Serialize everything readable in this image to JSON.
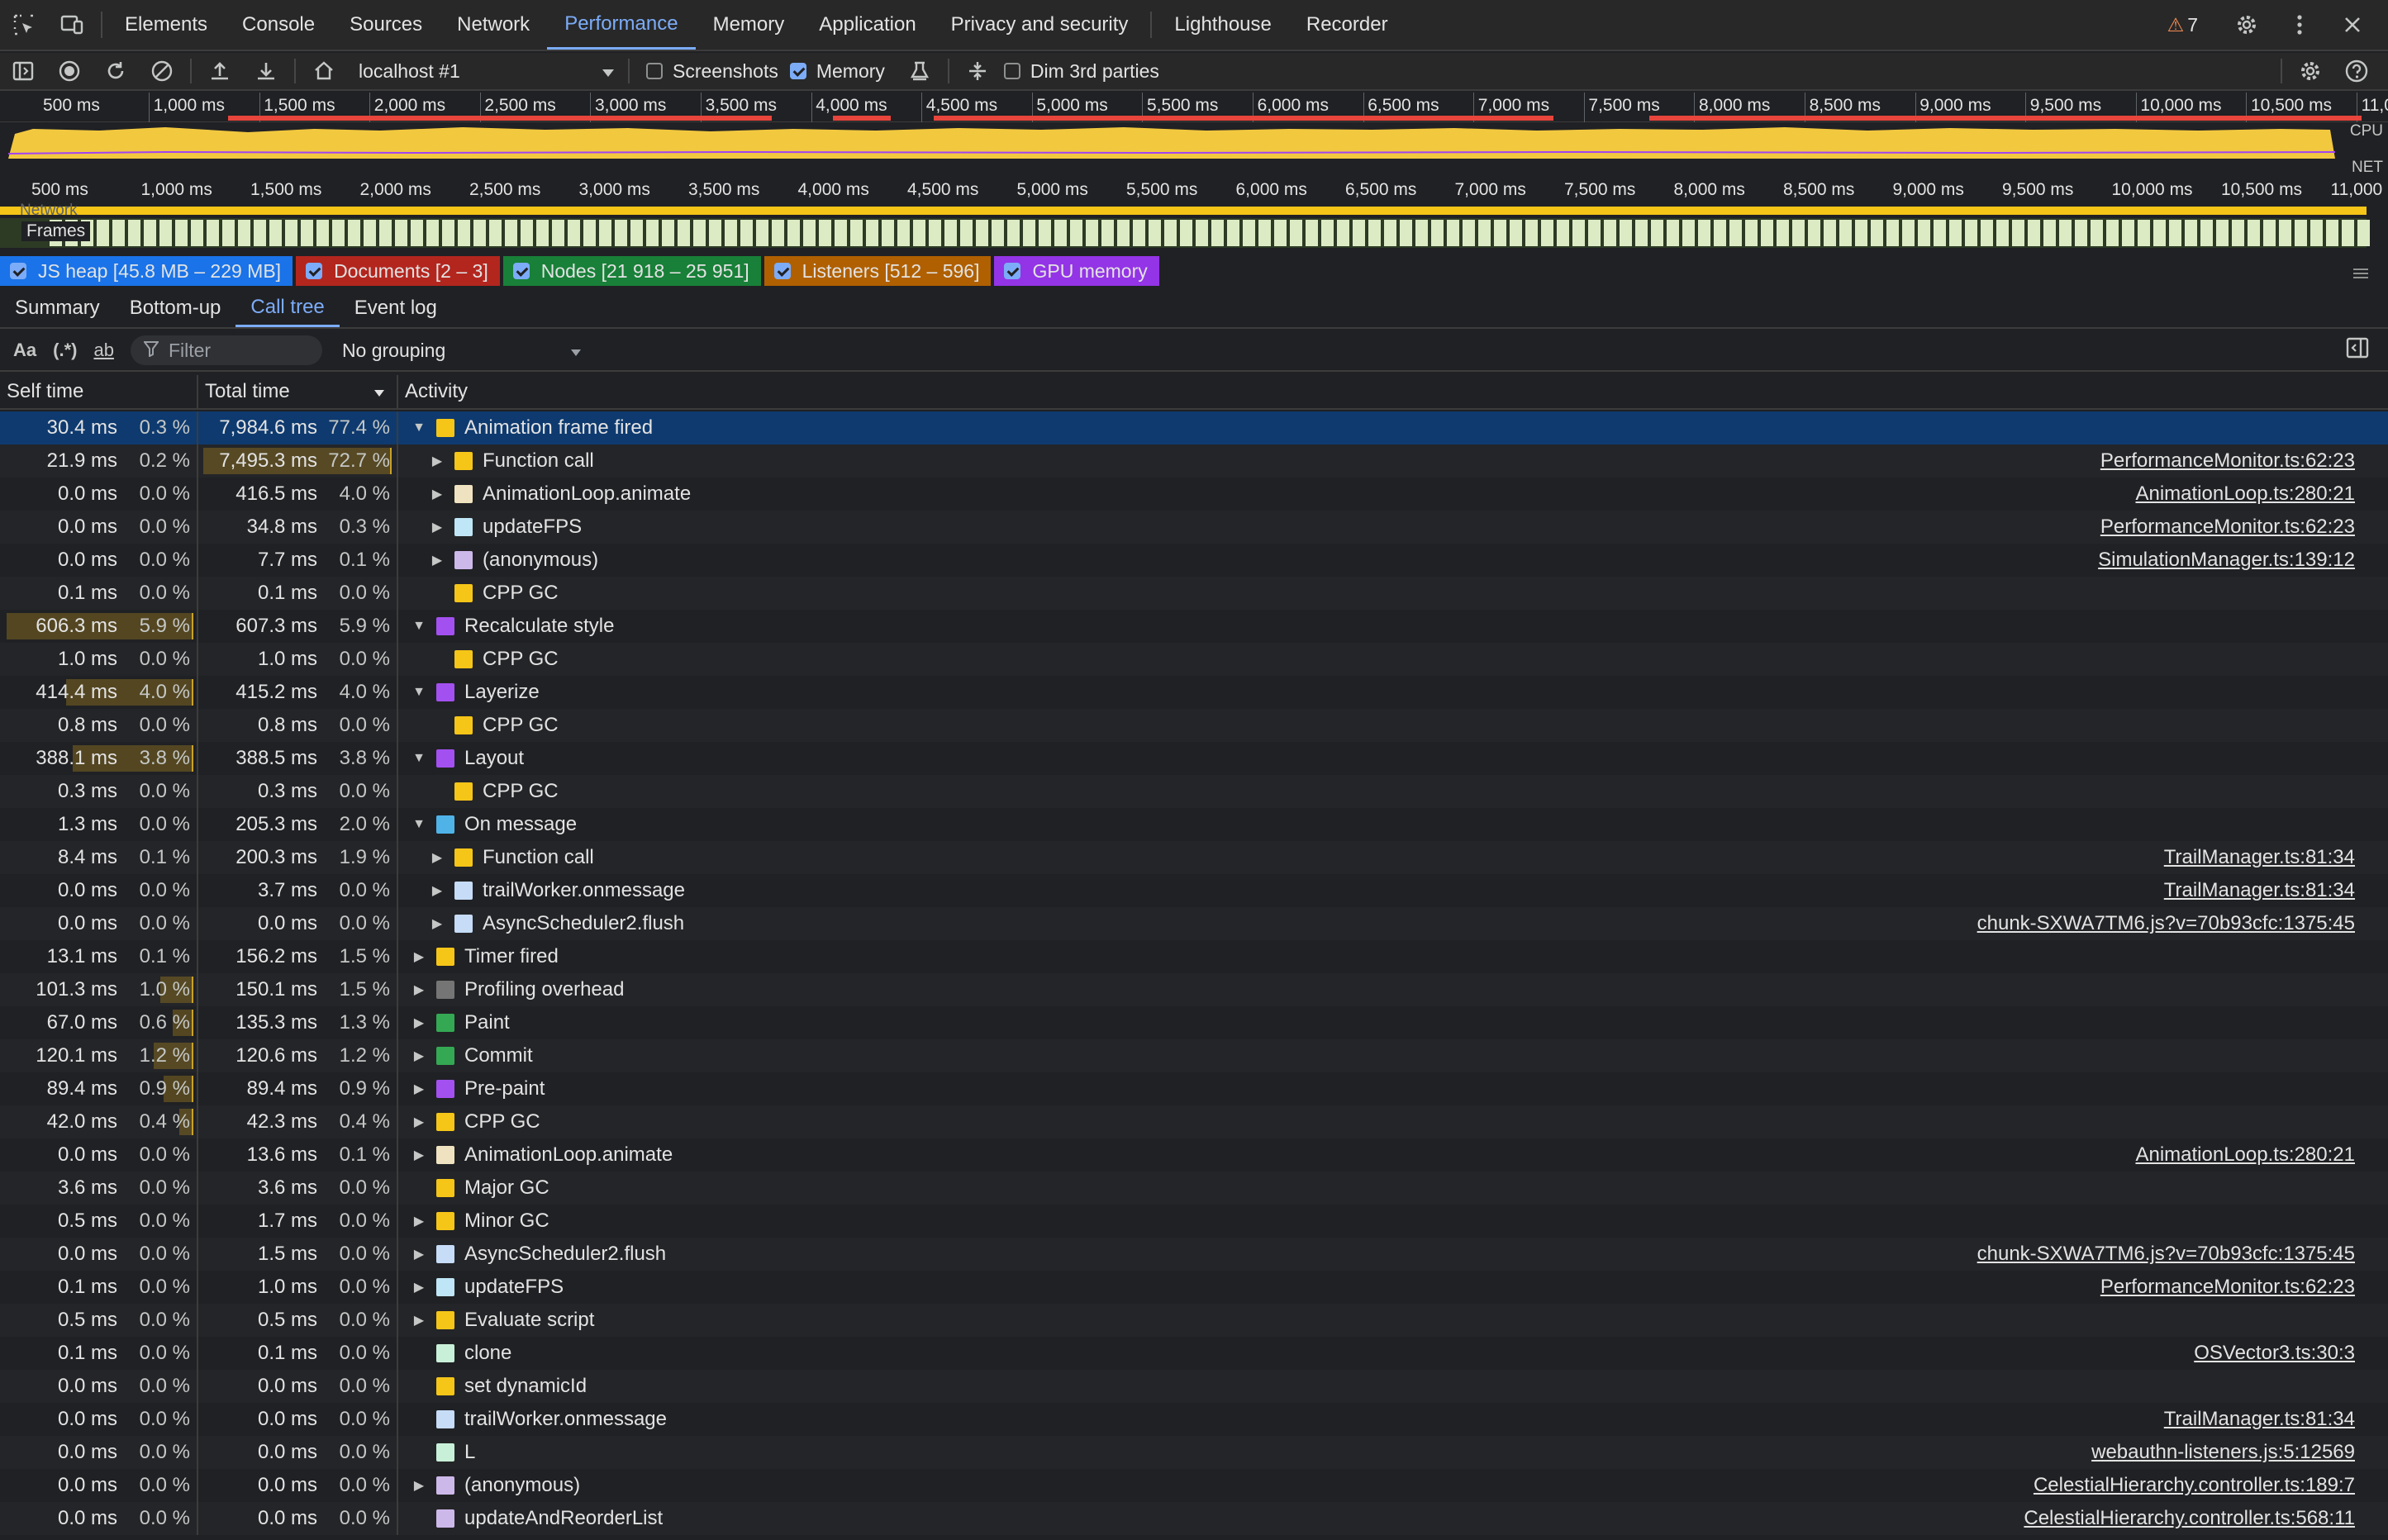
{
  "tabs": [
    "Elements",
    "Console",
    "Sources",
    "Network",
    "Performance",
    "Memory",
    "Application",
    "Privacy and security",
    "Lighthouse",
    "Recorder"
  ],
  "active_tab": "Performance",
  "issues_count": "7",
  "toolbar": {
    "target": "localhost #1",
    "screenshots_label": "Screenshots",
    "memory_label": "Memory",
    "dim_label": "Dim 3rd parties"
  },
  "ruler_top": [
    "500 ms",
    "1,000 ms",
    "1,500 ms",
    "2,000 ms",
    "2,500 ms",
    "3,000 ms",
    "3,500 ms",
    "4,000 ms",
    "4,500 ms",
    "5,000 ms",
    "5,500 ms",
    "6,000 ms",
    "6,500 ms",
    "7,000 ms",
    "7,500 ms",
    "8,000 ms",
    "8,500 ms",
    "9,000 ms",
    "9,500 ms",
    "10,000 ms",
    "10,500 ms",
    "11,0"
  ],
  "ruler_bottom": [
    "500 ms",
    "1,000 ms",
    "1,500 ms",
    "2,000 ms",
    "2,500 ms",
    "3,000 ms",
    "3,500 ms",
    "4,000 ms",
    "4,500 ms",
    "5,000 ms",
    "5,500 ms",
    "6,000 ms",
    "6,500 ms",
    "7,000 ms",
    "7,500 ms",
    "8,000 ms",
    "8,500 ms",
    "9,000 ms",
    "9,500 ms",
    "10,000 ms",
    "10,500 ms",
    "11,000"
  ],
  "cpu_label": "CPU",
  "net_label": "NET",
  "network_label": "Network",
  "frames_label": "Frames",
  "counters": [
    {
      "label": "JS heap [45.8 MB – 229 MB]",
      "color": "#1a73e8"
    },
    {
      "label": "Documents [2 – 3]",
      "color": "#b3261e"
    },
    {
      "label": "Nodes [21 918 – 25 951]",
      "color": "#188038"
    },
    {
      "label": "Listeners [512 – 596]",
      "color": "#b06000"
    },
    {
      "label": "GPU memory",
      "color": "#9334e6"
    }
  ],
  "detail_tabs": [
    "Summary",
    "Bottom-up",
    "Call tree",
    "Event log"
  ],
  "active_detail_tab": "Call tree",
  "filter_placeholder": "Filter",
  "grouping": "No grouping",
  "columns": {
    "self": "Self time",
    "total": "Total time",
    "activity": "Activity"
  },
  "rows": [
    {
      "self": "30.4 ms",
      "selfp": "0.3 %",
      "total": "7,984.6 ms",
      "totalp": "77.4 %",
      "name": "Animation frame fired",
      "indent": 0,
      "arrow": "down",
      "color": "#f5c518",
      "link": ""
    },
    {
      "self": "21.9 ms",
      "selfp": "0.2 %",
      "total": "7,495.3 ms",
      "totalp": "72.7 %",
      "name": "Function call",
      "indent": 1,
      "arrow": "right",
      "color": "#f5c518",
      "link": "PerformanceMonitor.ts:62:23"
    },
    {
      "self": "0.0 ms",
      "selfp": "0.0 %",
      "total": "416.5 ms",
      "totalp": "4.0 %",
      "name": "AnimationLoop.animate",
      "indent": 1,
      "arrow": "right",
      "color": "#efe2c0",
      "link": "AnimationLoop.ts:280:21"
    },
    {
      "self": "0.0 ms",
      "selfp": "0.0 %",
      "total": "34.8 ms",
      "totalp": "0.3 %",
      "name": "updateFPS",
      "indent": 1,
      "arrow": "right",
      "color": "#bfe6f7",
      "link": "PerformanceMonitor.ts:62:23"
    },
    {
      "self": "0.0 ms",
      "selfp": "0.0 %",
      "total": "7.7 ms",
      "totalp": "0.1 %",
      "name": "(anonymous)",
      "indent": 1,
      "arrow": "right",
      "color": "#cdb8ea",
      "link": "SimulationManager.ts:139:12"
    },
    {
      "self": "0.1 ms",
      "selfp": "0.0 %",
      "total": "0.1 ms",
      "totalp": "0.0 %",
      "name": "CPP GC",
      "indent": 1,
      "arrow": "",
      "color": "#f5c518",
      "link": ""
    },
    {
      "self": "606.3 ms",
      "selfp": "5.9 %",
      "total": "607.3 ms",
      "totalp": "5.9 %",
      "name": "Recalculate style",
      "indent": 0,
      "arrow": "down",
      "color": "#a350f0",
      "link": ""
    },
    {
      "self": "1.0 ms",
      "selfp": "0.0 %",
      "total": "1.0 ms",
      "totalp": "0.0 %",
      "name": "CPP GC",
      "indent": 1,
      "arrow": "",
      "color": "#f5c518",
      "link": ""
    },
    {
      "self": "414.4 ms",
      "selfp": "4.0 %",
      "total": "415.2 ms",
      "totalp": "4.0 %",
      "name": "Layerize",
      "indent": 0,
      "arrow": "down",
      "color": "#a350f0",
      "link": ""
    },
    {
      "self": "0.8 ms",
      "selfp": "0.0 %",
      "total": "0.8 ms",
      "totalp": "0.0 %",
      "name": "CPP GC",
      "indent": 1,
      "arrow": "",
      "color": "#f5c518",
      "link": ""
    },
    {
      "self": "388.1 ms",
      "selfp": "3.8 %",
      "total": "388.5 ms",
      "totalp": "3.8 %",
      "name": "Layout",
      "indent": 0,
      "arrow": "down",
      "color": "#a350f0",
      "link": ""
    },
    {
      "self": "0.3 ms",
      "selfp": "0.0 %",
      "total": "0.3 ms",
      "totalp": "0.0 %",
      "name": "CPP GC",
      "indent": 1,
      "arrow": "",
      "color": "#f5c518",
      "link": ""
    },
    {
      "self": "1.3 ms",
      "selfp": "0.0 %",
      "total": "205.3 ms",
      "totalp": "2.0 %",
      "name": "On message",
      "indent": 0,
      "arrow": "down",
      "color": "#4fb3e8",
      "link": ""
    },
    {
      "self": "8.4 ms",
      "selfp": "0.1 %",
      "total": "200.3 ms",
      "totalp": "1.9 %",
      "name": "Function call",
      "indent": 1,
      "arrow": "right",
      "color": "#f5c518",
      "link": "TrailManager.ts:81:34"
    },
    {
      "self": "0.0 ms",
      "selfp": "0.0 %",
      "total": "3.7 ms",
      "totalp": "0.0 %",
      "name": "trailWorker.onmessage",
      "indent": 1,
      "arrow": "right",
      "color": "#c6dcf7",
      "link": "TrailManager.ts:81:34"
    },
    {
      "self": "0.0 ms",
      "selfp": "0.0 %",
      "total": "0.0 ms",
      "totalp": "0.0 %",
      "name": "AsyncScheduler2.flush",
      "indent": 1,
      "arrow": "right",
      "color": "#c6dcf7",
      "link": "chunk-SXWA7TM6.js?v=70b93cfc:1375:45"
    },
    {
      "self": "13.1 ms",
      "selfp": "0.1 %",
      "total": "156.2 ms",
      "totalp": "1.5 %",
      "name": "Timer fired",
      "indent": 0,
      "arrow": "right",
      "color": "#f5c518",
      "link": ""
    },
    {
      "self": "101.3 ms",
      "selfp": "1.0 %",
      "total": "150.1 ms",
      "totalp": "1.5 %",
      "name": "Profiling overhead",
      "indent": 0,
      "arrow": "right",
      "color": "#757575",
      "link": ""
    },
    {
      "self": "67.0 ms",
      "selfp": "0.6 %",
      "total": "135.3 ms",
      "totalp": "1.3 %",
      "name": "Paint",
      "indent": 0,
      "arrow": "right",
      "color": "#34a853",
      "link": ""
    },
    {
      "self": "120.1 ms",
      "selfp": "1.2 %",
      "total": "120.6 ms",
      "totalp": "1.2 %",
      "name": "Commit",
      "indent": 0,
      "arrow": "right",
      "color": "#34a853",
      "link": ""
    },
    {
      "self": "89.4 ms",
      "selfp": "0.9 %",
      "total": "89.4 ms",
      "totalp": "0.9 %",
      "name": "Pre-paint",
      "indent": 0,
      "arrow": "right",
      "color": "#a350f0",
      "link": ""
    },
    {
      "self": "42.0 ms",
      "selfp": "0.4 %",
      "total": "42.3 ms",
      "totalp": "0.4 %",
      "name": "CPP GC",
      "indent": 0,
      "arrow": "right",
      "color": "#f5c518",
      "link": ""
    },
    {
      "self": "0.0 ms",
      "selfp": "0.0 %",
      "total": "13.6 ms",
      "totalp": "0.1 %",
      "name": "AnimationLoop.animate",
      "indent": 0,
      "arrow": "right",
      "color": "#efe2c0",
      "link": "AnimationLoop.ts:280:21"
    },
    {
      "self": "3.6 ms",
      "selfp": "0.0 %",
      "total": "3.6 ms",
      "totalp": "0.0 %",
      "name": "Major GC",
      "indent": 0,
      "arrow": "",
      "color": "#f5c518",
      "link": ""
    },
    {
      "self": "0.5 ms",
      "selfp": "0.0 %",
      "total": "1.7 ms",
      "totalp": "0.0 %",
      "name": "Minor GC",
      "indent": 0,
      "arrow": "right",
      "color": "#f5c518",
      "link": ""
    },
    {
      "self": "0.0 ms",
      "selfp": "0.0 %",
      "total": "1.5 ms",
      "totalp": "0.0 %",
      "name": "AsyncScheduler2.flush",
      "indent": 0,
      "arrow": "right",
      "color": "#c6dcf7",
      "link": "chunk-SXWA7TM6.js?v=70b93cfc:1375:45"
    },
    {
      "self": "0.1 ms",
      "selfp": "0.0 %",
      "total": "1.0 ms",
      "totalp": "0.0 %",
      "name": "updateFPS",
      "indent": 0,
      "arrow": "right",
      "color": "#bfe6f7",
      "link": "PerformanceMonitor.ts:62:23"
    },
    {
      "self": "0.5 ms",
      "selfp": "0.0 %",
      "total": "0.5 ms",
      "totalp": "0.0 %",
      "name": "Evaluate script",
      "indent": 0,
      "arrow": "right",
      "color": "#f5c518",
      "link": ""
    },
    {
      "self": "0.1 ms",
      "selfp": "0.0 %",
      "total": "0.1 ms",
      "totalp": "0.0 %",
      "name": "clone",
      "indent": 0,
      "arrow": "",
      "color": "#c8f0d8",
      "link": "OSVector3.ts:30:3"
    },
    {
      "self": "0.0 ms",
      "selfp": "0.0 %",
      "total": "0.0 ms",
      "totalp": "0.0 %",
      "name": "set dynamicId",
      "indent": 0,
      "arrow": "",
      "color": "#f5c518",
      "link": ""
    },
    {
      "self": "0.0 ms",
      "selfp": "0.0 %",
      "total": "0.0 ms",
      "totalp": "0.0 %",
      "name": "trailWorker.onmessage",
      "indent": 0,
      "arrow": "",
      "color": "#c6dcf7",
      "link": "TrailManager.ts:81:34"
    },
    {
      "self": "0.0 ms",
      "selfp": "0.0 %",
      "total": "0.0 ms",
      "totalp": "0.0 %",
      "name": "L",
      "indent": 0,
      "arrow": "",
      "color": "#c8f0d8",
      "link": "webauthn-listeners.js:5:12569"
    },
    {
      "self": "0.0 ms",
      "selfp": "0.0 %",
      "total": "0.0 ms",
      "totalp": "0.0 %",
      "name": "(anonymous)",
      "indent": 0,
      "arrow": "right",
      "color": "#cdb8ea",
      "link": "CelestialHierarchy.controller.ts:189:7"
    },
    {
      "self": "0.0 ms",
      "selfp": "0.0 %",
      "total": "0.0 ms",
      "totalp": "0.0 %",
      "name": "updateAndReorderList",
      "indent": 0,
      "arrow": "",
      "color": "#cdb8ea",
      "link": "CelestialHierarchy.controller.ts:568:11"
    }
  ]
}
